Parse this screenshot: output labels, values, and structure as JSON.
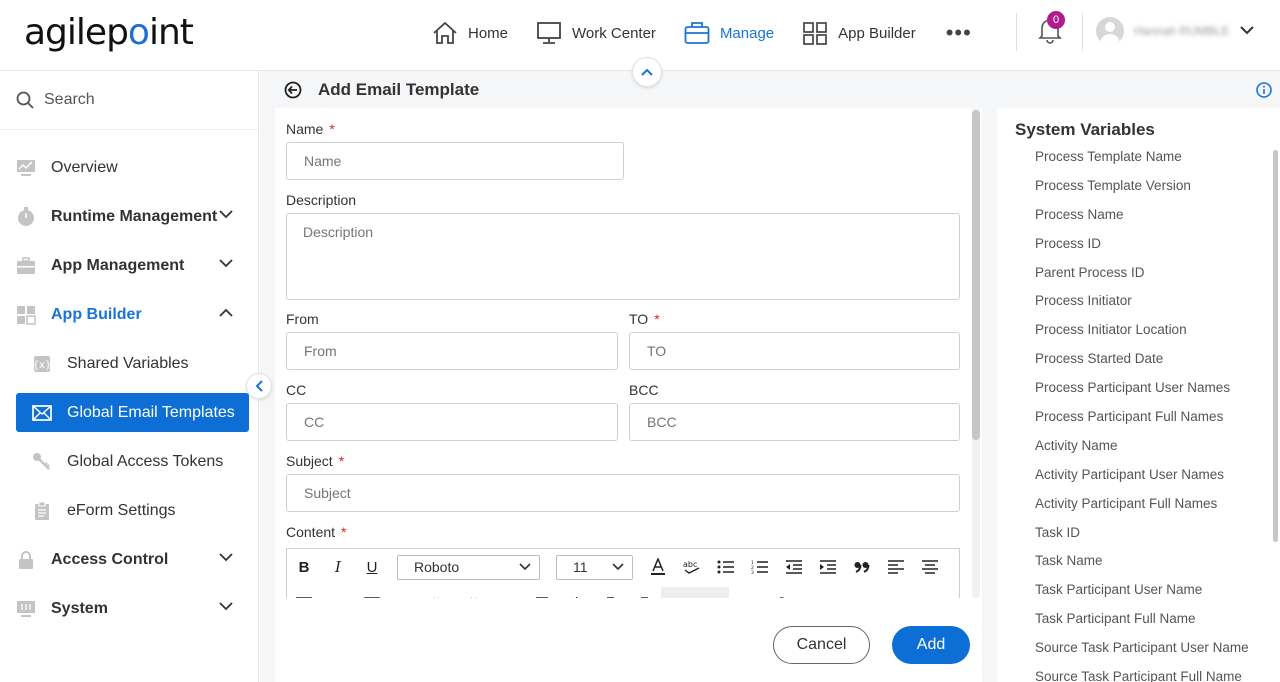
{
  "logo": {
    "text_before": "agilep",
    "text_dot": "o",
    "text_after": "int"
  },
  "nav": {
    "items": [
      {
        "label": "Home",
        "icon": "home-icon"
      },
      {
        "label": "Work Center",
        "icon": "monitor-icon"
      },
      {
        "label": "Manage",
        "icon": "briefcase-icon",
        "active": true
      },
      {
        "label": "App Builder",
        "icon": "grid-icon"
      }
    ],
    "more": "•••",
    "notification_count": "0",
    "user_name": "Hannah RUMBLE"
  },
  "sidebar": {
    "search_label": "Search",
    "items": [
      {
        "label": "Overview",
        "icon": "chart-icon"
      },
      {
        "label": "Runtime Management",
        "icon": "timer-icon",
        "expandable": true
      },
      {
        "label": "App Management",
        "icon": "toolbox-icon",
        "expandable": true
      },
      {
        "label": "App Builder",
        "icon": "widgets-icon",
        "expandable": true,
        "expanded": true
      },
      {
        "label": "Shared Variables",
        "icon": "variable-icon"
      },
      {
        "label": "Global Email Templates",
        "icon": "mail-icon",
        "selected": true
      },
      {
        "label": "Global Access Tokens",
        "icon": "key-icon"
      },
      {
        "label": "eForm Settings",
        "icon": "clipboard-icon"
      },
      {
        "label": "Access Control",
        "icon": "lock-icon",
        "expandable": true
      },
      {
        "label": "System",
        "icon": "system-icon",
        "expandable": true
      }
    ]
  },
  "page": {
    "title": "Add Email Template"
  },
  "form": {
    "name": {
      "label": "Name",
      "placeholder": "Name",
      "required": "*"
    },
    "description": {
      "label": "Description",
      "placeholder": "Description"
    },
    "from": {
      "label": "From",
      "placeholder": "From"
    },
    "to": {
      "label": "TO",
      "placeholder": "TO",
      "required": "*"
    },
    "cc": {
      "label": "CC",
      "placeholder": "CC"
    },
    "bcc": {
      "label": "BCC",
      "placeholder": "BCC"
    },
    "subject": {
      "label": "Subject",
      "placeholder": "Subject",
      "required": "*"
    },
    "content": {
      "label": "Content",
      "required": "*"
    },
    "toolbar": {
      "bold": "B",
      "italic": "I",
      "underline": "U",
      "font_family": "Roboto",
      "font_size": "11"
    },
    "cancel_label": "Cancel",
    "add_label": "Add"
  },
  "system_variables": {
    "title": "System Variables",
    "items": [
      "Process Template Name",
      "Process Template Version",
      "Process Name",
      "Process ID",
      "Parent Process ID",
      "Process Initiator",
      "Process Initiator Location",
      "Process Started Date",
      "Process Participant User Names",
      "Process Participant Full Names",
      "Activity Name",
      "Activity Participant User Names",
      "Activity Participant Full Names",
      "Task ID",
      "Task Name",
      "Task Participant User Name",
      "Task Participant Full Name",
      "Source Task Participant User Name",
      "Source Task Participant Full Name"
    ]
  },
  "colors": {
    "accent": "#0d6fd6",
    "required": "#d9262c",
    "badge": "#b01c8e"
  }
}
